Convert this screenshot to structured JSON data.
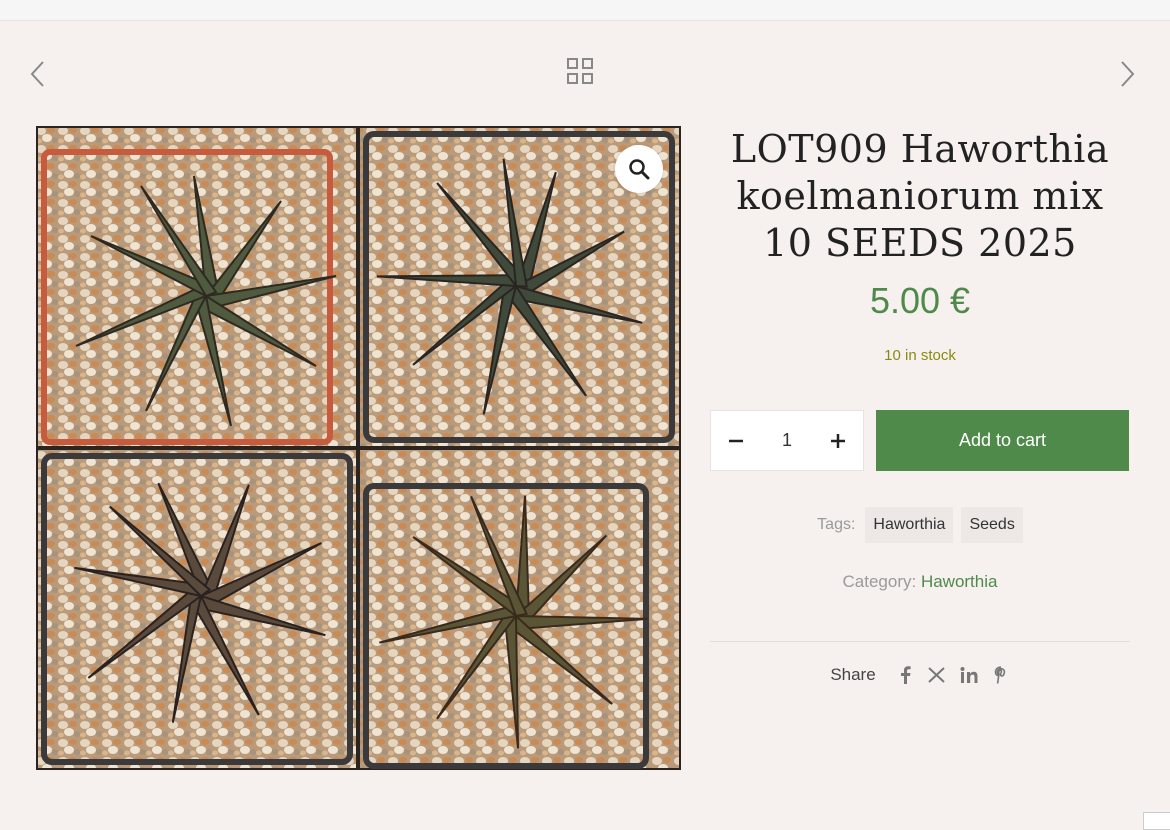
{
  "nav": {
    "prev_icon": "chevron-left-icon",
    "grid_icon": "grid-icon",
    "next_icon": "chevron-right-icon"
  },
  "gallery": {
    "image_alt": "Haworthia koelmaniorum seedlings in four pots",
    "zoom_icon": "magnifier-icon"
  },
  "product": {
    "title": "LOT909 Haworthia koelmaniorum mix 10 SEEDS 2025",
    "price": "5.00 €",
    "stock": "10 in stock"
  },
  "cart": {
    "minus": "−",
    "quantity": "1",
    "plus": "+",
    "add_label": "Add to cart"
  },
  "tags": {
    "label": "Tags:",
    "items": [
      "Haworthia",
      "Seeds"
    ]
  },
  "category": {
    "label": "Category:",
    "value": "Haworthia"
  },
  "share": {
    "label": "Share",
    "icons": [
      "facebook-icon",
      "x-icon",
      "linkedin-icon",
      "pinterest-icon"
    ]
  },
  "colors": {
    "accent": "#4f8a4b",
    "stock": "#8a8a12",
    "background": "#f6f1ef"
  }
}
